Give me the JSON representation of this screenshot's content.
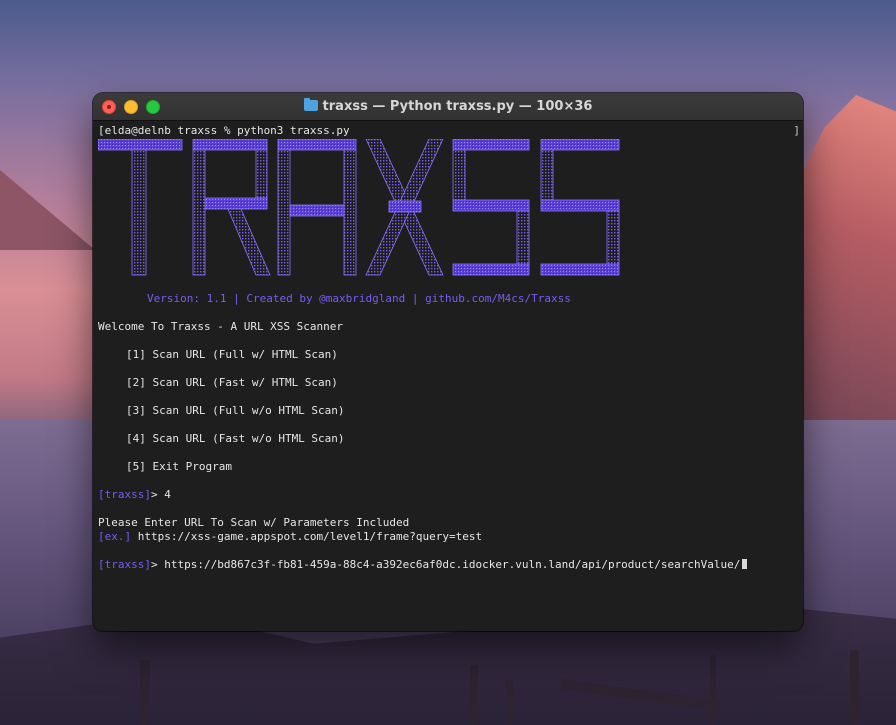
{
  "window": {
    "title": "traxss — Python traxss.py — 100×36"
  },
  "terminal": {
    "prompt_line": "[elda@delnb traxss % python3 traxss.py",
    "right_bracket": "]",
    "logo_text": "TRAXSS",
    "version_line": "Version: 1.1 | Created by @maxbridgland | github.com/M4cs/Traxss",
    "welcome": "Welcome To Traxss - A URL XSS Scanner",
    "menu": [
      "[1] Scan URL (Full w/ HTML Scan)",
      "[2] Scan URL (Fast w/ HTML Scan)",
      "[3] Scan URL (Full w/o HTML Scan)",
      "[4] Scan URL (Fast w/o HTML Scan)",
      "[5] Exit Program"
    ],
    "choice_prompt": "[traxss]",
    "choice_value": "> 4",
    "enter_url_text": "Please Enter URL To Scan w/ Parameters Included",
    "example_tag": "[ex.]",
    "example_url": " https://xss-game.appspot.com/level1/frame?query=test",
    "url_prompt": "[traxss]",
    "url_value": "> https://bd867c3f-fb81-459a-88c4-a392ec6af0dc.idocker.vuln.land/api/product/searchValue/"
  },
  "colors": {
    "accent_purple": "#7a5cf0",
    "terminal_bg": "#1e1e1e",
    "text": "#e6e6e6"
  }
}
